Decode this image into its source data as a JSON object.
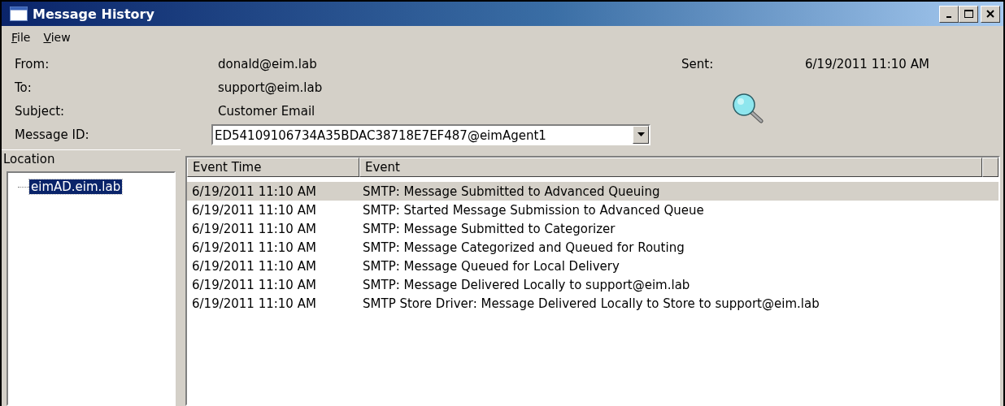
{
  "window": {
    "title": "Message History"
  },
  "menu": [
    {
      "label": "File"
    },
    {
      "label": "View"
    }
  ],
  "header": {
    "from_label": "From:",
    "from": "donald@eim.lab",
    "sent_label": "Sent:",
    "sent": "6/19/2011  11:10 AM",
    "to_label": "To:",
    "to": "support@eim.lab",
    "subject_label": "Subject:",
    "subject": "Customer Email",
    "message_id_label": "Message ID:",
    "message_id": "ED54109106734A35BDAC38718E7EF487@eimAgent1"
  },
  "location": {
    "heading": "Location",
    "items": [
      {
        "label": "eimAD.eim.lab",
        "selected": true
      }
    ]
  },
  "events": {
    "columns": [
      "Event Time",
      "Event"
    ],
    "rows": [
      {
        "time": "6/19/2011  11:10 AM",
        "event": "SMTP: Message Submitted to Advanced Queuing",
        "selected": true
      },
      {
        "time": "6/19/2011  11:10 AM",
        "event": "SMTP: Started Message Submission to Advanced Queue",
        "selected": false
      },
      {
        "time": "6/19/2011  11:10 AM",
        "event": "SMTP: Message Submitted to Categorizer",
        "selected": false
      },
      {
        "time": "6/19/2011  11:10 AM",
        "event": "SMTP: Message Categorized and Queued for Routing",
        "selected": false
      },
      {
        "time": "6/19/2011  11:10 AM",
        "event": "SMTP: Message Queued for Local Delivery",
        "selected": false
      },
      {
        "time": "6/19/2011  11:10 AM",
        "event": "SMTP: Message Delivered Locally to support@eim.lab",
        "selected": false
      },
      {
        "time": "6/19/2011  11:10 AM",
        "event": "SMTP Store Driver: Message Delivered Locally to Store to support@eim.lab",
        "selected": false
      }
    ]
  }
}
